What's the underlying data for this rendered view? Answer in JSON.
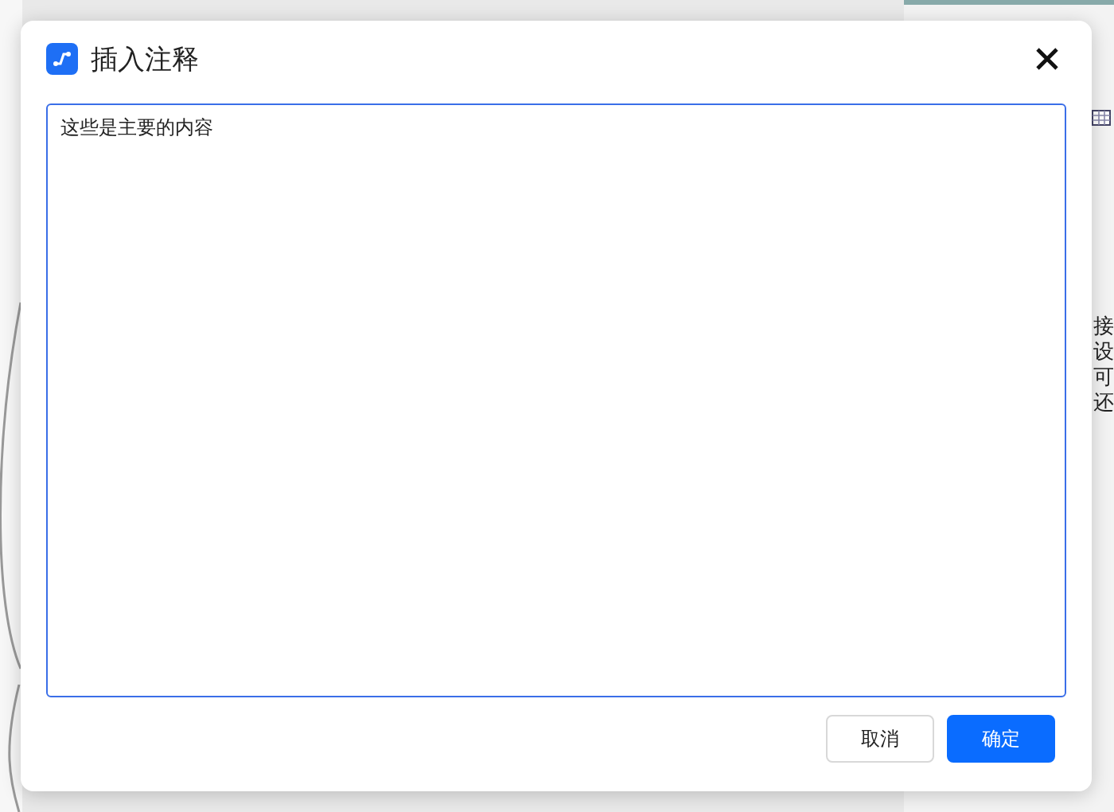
{
  "background": {
    "side_texts": [
      "接",
      "设",
      "可",
      "还"
    ]
  },
  "dialog": {
    "title": "插入注释",
    "note": {
      "value": "这些是主要的内容",
      "focused": true
    },
    "buttons": [
      {
        "label": "取消",
        "kind": "secondary"
      },
      {
        "label": "确定",
        "kind": "primary"
      }
    ]
  }
}
